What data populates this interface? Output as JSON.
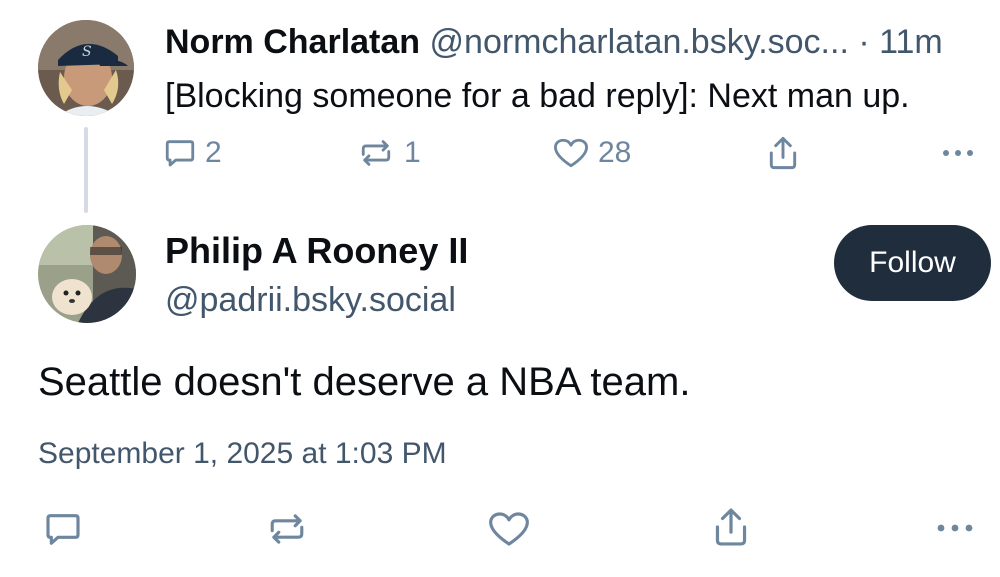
{
  "parent_post": {
    "author_name": "Norm Charlatan",
    "author_handle": "@normcharlatan.bsky.soc...",
    "separator": "·",
    "timestamp": "11m",
    "text": "[Blocking someone for a bad reply]: Next man up.",
    "reply_count": "2",
    "repost_count": "1",
    "like_count": "28",
    "avatar_icon": "seattle-mariners-player-avatar"
  },
  "reply_post": {
    "author_name": "Philip A Rooney II",
    "author_handle": "@padrii.bsky.social",
    "follow_label": "Follow",
    "text": "Seattle doesn't deserve a NBA team.",
    "date": "September 1, 2025 at 1:03 PM",
    "avatar_icon": "man-with-dog-avatar"
  },
  "colors": {
    "icon_gray": "#6f869f",
    "secondary_text": "#42576c",
    "follow_bg": "#1f2d3c",
    "thread_line": "#d4dbe2"
  }
}
